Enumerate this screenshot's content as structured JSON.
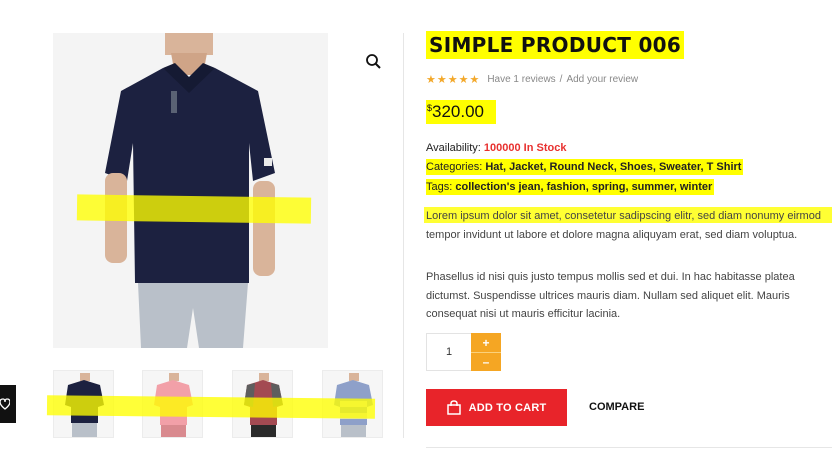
{
  "product": {
    "title": "SIMPLE PRODUCT 006",
    "rating_stars": 5,
    "stars_glyphs": "★★★★★",
    "reviews_text": "Have 1 reviews",
    "separator": "/",
    "add_review_text": "Add your review",
    "currency": "$",
    "price": "320.00",
    "availability_label": "Availability:",
    "availability_value": "100000 In Stock",
    "categories_label": "Categories:",
    "categories": "Hat, Jacket, Round Neck, Shoes, Sweater, T Shirt",
    "tags_label": "Tags:",
    "tags": "collection's jean, fashion, spring, summer, winter",
    "description_1": "Lorem ipsum dolor sit amet, consetetur sadipscing elitr, sed diam nonumy eirmod tempor invidunt ut labore et dolore magna aliquyam erat, sed diam voluptua.",
    "description_2": "Phasellus id nisi quis justo tempus mollis sed et dui. In hac habitasse platea dictumst. Suspendisse ultrices mauris diam. Nullam sed aliquet elit. Mauris consequat nisi ut mauris efficitur lacinia."
  },
  "quantity": {
    "value": "1",
    "plus": "+",
    "minus": "–"
  },
  "actions": {
    "add_to_cart": "ADD TO CART",
    "compare": "COMPARE"
  },
  "icons": {
    "zoom": "search-icon",
    "cart": "bag-icon",
    "side_widget": "heart-icon"
  },
  "thumbnails": [
    {
      "name": "navy polo",
      "shirt_color": "#1c2140"
    },
    {
      "name": "pink tee",
      "shirt_color": "#f2a0a8"
    },
    {
      "name": "grey raglan",
      "shirt_color": "#a34a52"
    },
    {
      "name": "striped tee",
      "shirt_color": "#8ea0c9"
    }
  ],
  "colors": {
    "accent": "#e8242a",
    "stock": "#e8312f",
    "star": "#f3a82a",
    "qty_button": "#f5a623",
    "highlight": "#ffff00"
  }
}
